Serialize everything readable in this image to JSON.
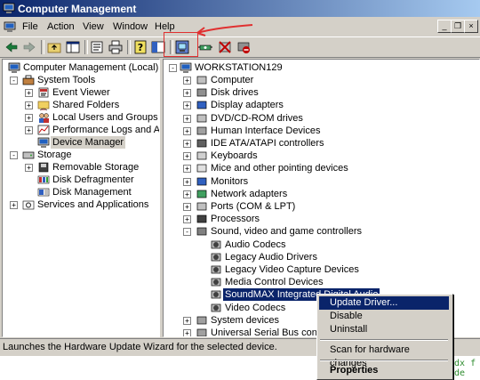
{
  "window": {
    "title": "Computer Management"
  },
  "menu": {
    "file": "File",
    "action": "Action",
    "view": "View",
    "window": "Window",
    "help": "Help"
  },
  "mdi_controls": {
    "minimize": "_",
    "restore": "❐",
    "close": "×"
  },
  "toolbar": {
    "icons": [
      "back-arrow-icon",
      "forward-arrow-icon",
      "up-folder-icon",
      "show-hide-tree-icon",
      "properties-icon",
      "print-icon",
      "help-icon",
      "console-tree-icon",
      "update-driver-icon",
      "scan-hardware-icon",
      "uninstall-icon",
      "disable-device-icon"
    ]
  },
  "left_tree": {
    "root": "Computer Management (Local)",
    "system_tools": "System Tools",
    "event_viewer": "Event Viewer",
    "shared_folders": "Shared Folders",
    "local_users": "Local Users and Groups",
    "perf_logs": "Performance Logs and Alerts",
    "device_manager": "Device Manager",
    "storage": "Storage",
    "removable_storage": "Removable Storage",
    "disk_defrag": "Disk Defragmenter",
    "disk_management": "Disk Management",
    "services_apps": "Services and Applications"
  },
  "right_tree": {
    "root": "WORKSTATION129",
    "items": [
      "Computer",
      "Disk drives",
      "Display adapters",
      "DVD/CD-ROM drives",
      "Human Interface Devices",
      "IDE ATA/ATAPI controllers",
      "Keyboards",
      "Mice and other pointing devices",
      "Monitors",
      "Network adapters",
      "Ports (COM & LPT)",
      "Processors",
      "Sound, video and game controllers"
    ],
    "sound_children": [
      "Audio Codecs",
      "Legacy Audio Drivers",
      "Legacy Video Capture Devices",
      "Media Control Devices",
      "SoundMAX Integrated Digital Audio",
      "Video Codecs"
    ],
    "after": [
      "System devices",
      "Universal Serial Bus controllers"
    ]
  },
  "context_menu": {
    "update_driver": "Update Driver...",
    "disable": "Disable",
    "uninstall": "Uninstall",
    "scan": "Scan for hardware changes",
    "properties": "Properties"
  },
  "status": {
    "text": "Launches the Hardware Update Wizard for the selected device."
  },
  "background_fragments": {
    "line1": "odx f",
    "line2": "ode"
  },
  "colors": {
    "title_start": "#0a246a",
    "title_end": "#a6caf0",
    "selection": "#0a246a",
    "annotation": "#e03030",
    "face": "#d4d0c8"
  }
}
